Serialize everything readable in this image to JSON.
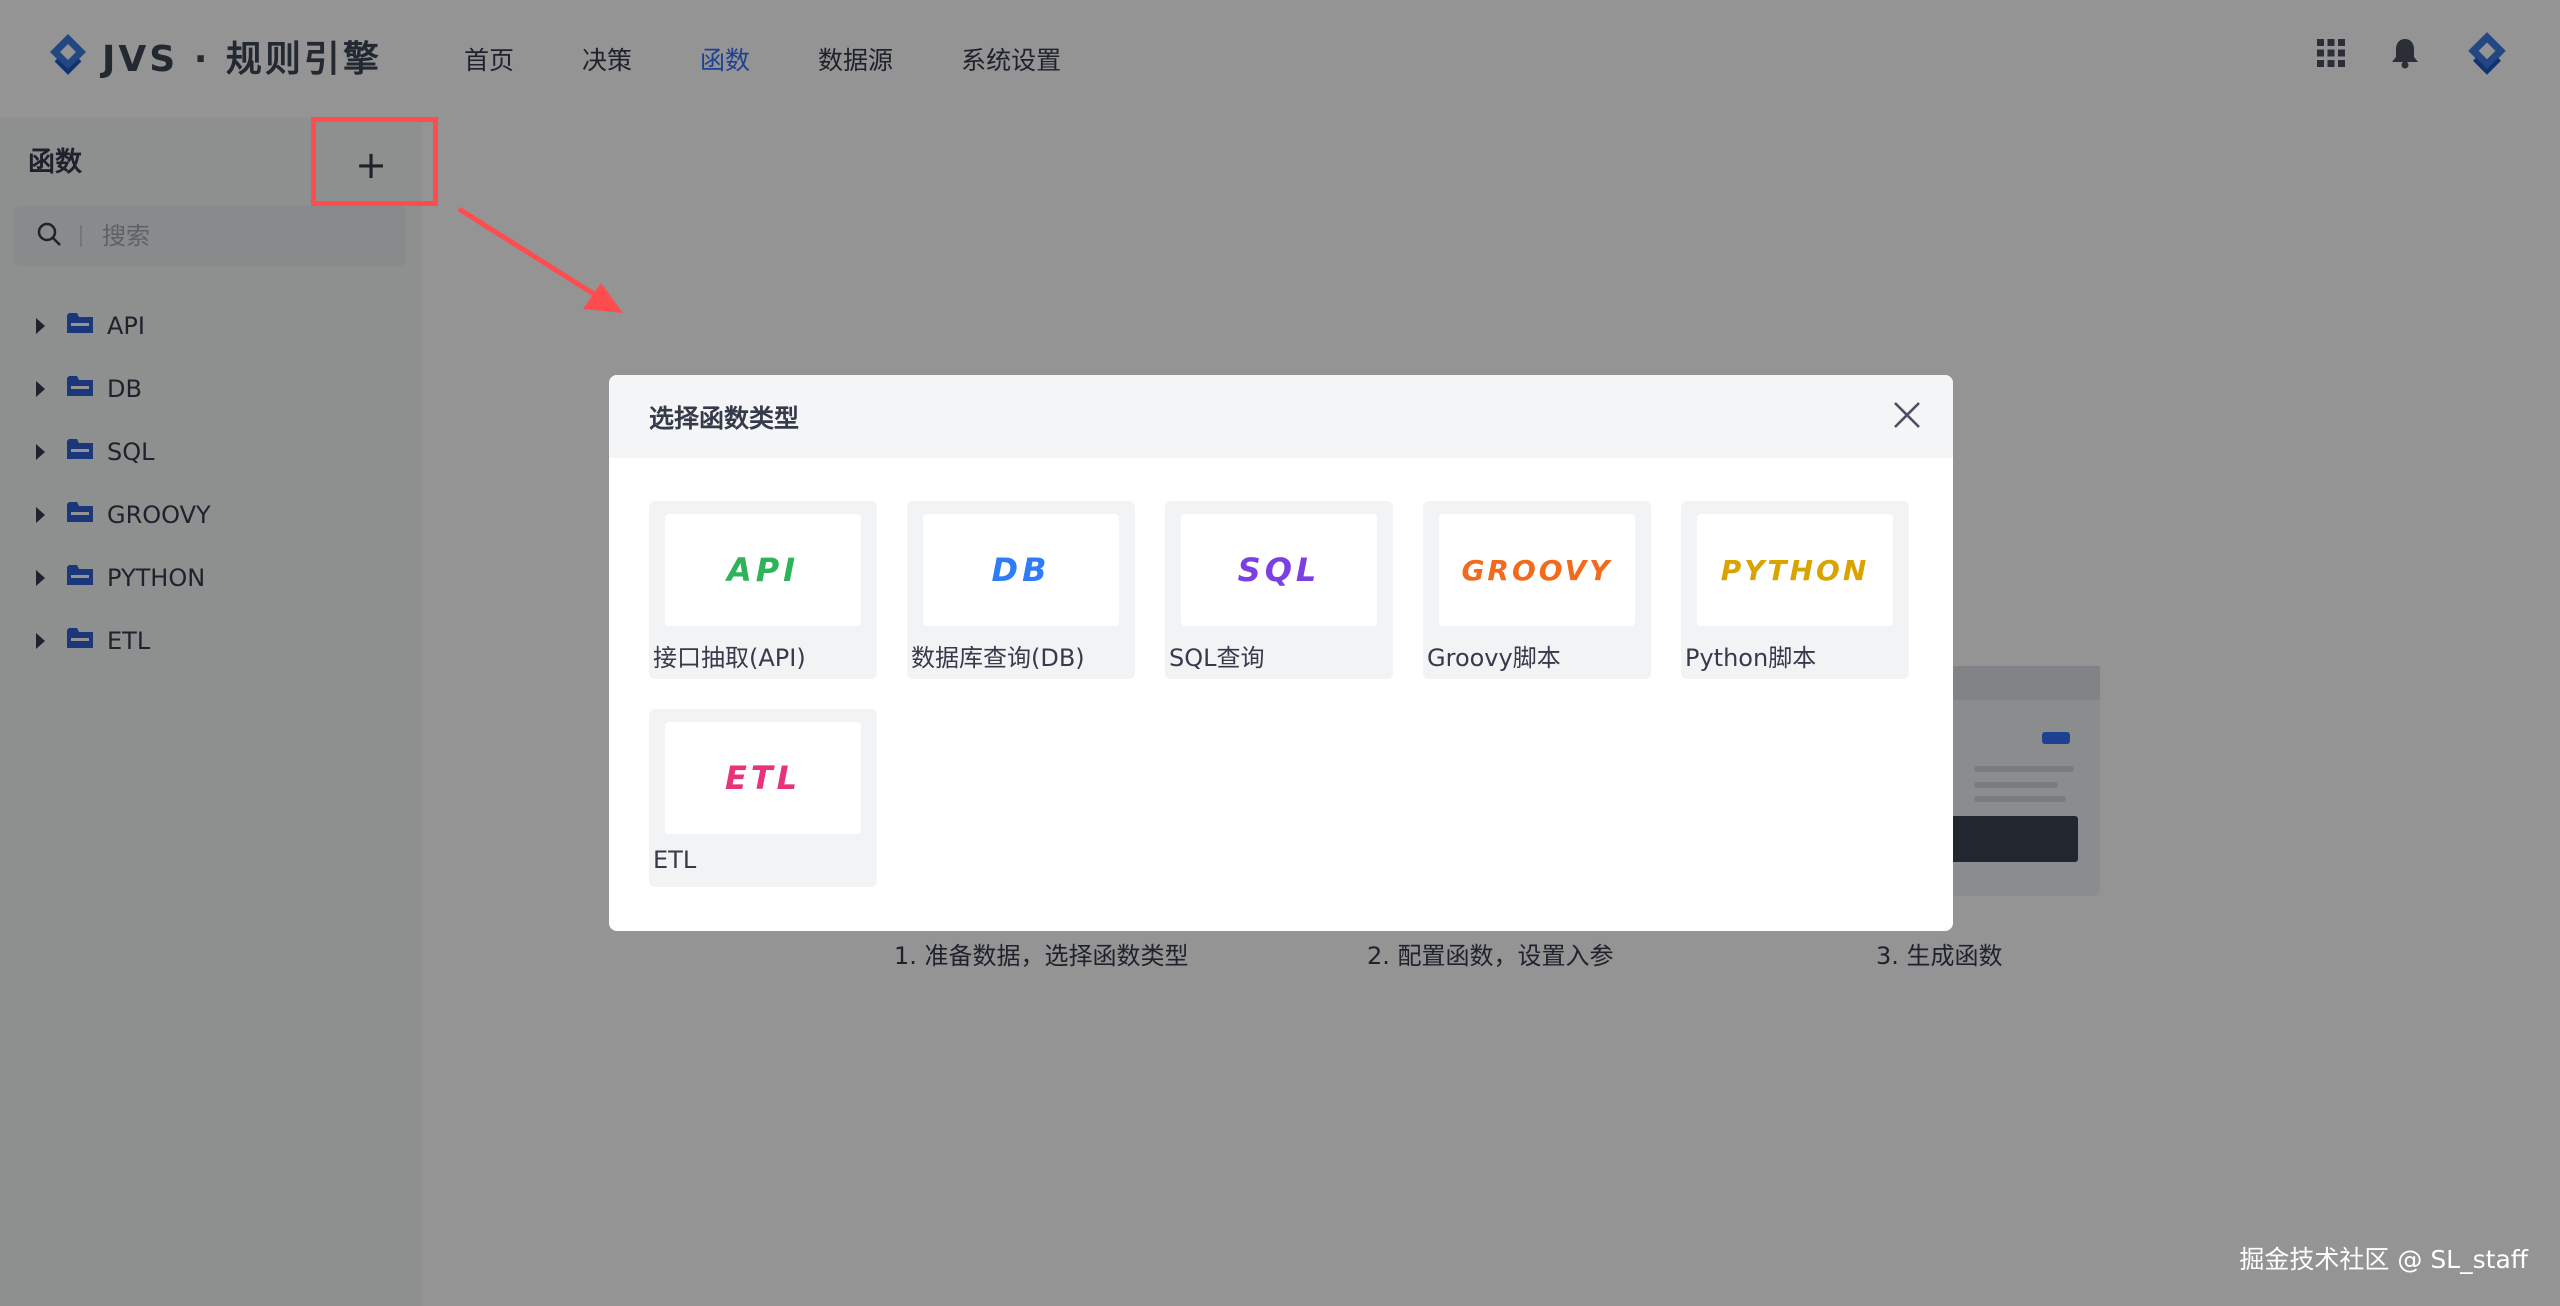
{
  "app": {
    "brand": "JVS · 规则引擎",
    "icons": {
      "logo": "jvs-logo-icon",
      "apps": "apps-grid-icon",
      "bell": "bell-icon",
      "avatar": "jvs-avatar-icon"
    },
    "colors": {
      "accent": "#3471ff",
      "highlight": "#ff4d4f",
      "folder": "#2f5fd0"
    }
  },
  "nav": {
    "items": [
      {
        "label": "首页"
      },
      {
        "label": "决策"
      },
      {
        "label": "函数"
      },
      {
        "label": "数据源"
      },
      {
        "label": "系统设置"
      }
    ],
    "active": "函数"
  },
  "sidebar": {
    "title": "函数",
    "add_symbol": "+",
    "search_placeholder": "搜索",
    "folders": [
      {
        "label": "API"
      },
      {
        "label": "DB"
      },
      {
        "label": "SQL"
      },
      {
        "label": "GROOVY"
      },
      {
        "label": "PYTHON"
      },
      {
        "label": "ETL"
      }
    ]
  },
  "main": {
    "steps": [
      {
        "label": "1. 准备数据，选择函数类型"
      },
      {
        "label": "2. 配置函数，设置入参"
      },
      {
        "label": "3. 生成函数"
      }
    ]
  },
  "modal": {
    "title": "选择函数类型",
    "types": [
      {
        "badge": "API",
        "label": "接口抽取(API)",
        "color": "#2fb35a"
      },
      {
        "badge": "DB",
        "label": "数据库查询(DB)",
        "color": "#2f7df6"
      },
      {
        "badge": "SQL",
        "label": "SQL查询",
        "color": "#7b3fe4"
      },
      {
        "badge": "GROOVY",
        "label": "Groovy脚本",
        "color": "#f26a1b"
      },
      {
        "badge": "PYTHON",
        "label": "Python脚本",
        "color": "#d9a300"
      },
      {
        "badge": "ETL",
        "label": "ETL",
        "color": "#e8337a"
      }
    ]
  },
  "watermark": "掘金技术社区 @ SL_staff"
}
